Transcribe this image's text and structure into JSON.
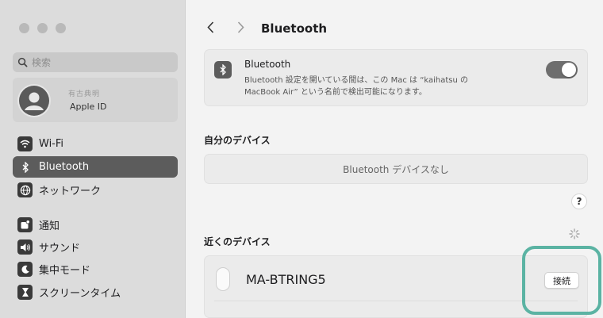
{
  "window": {
    "title": "Bluetooth",
    "traffic_lights": [
      "close",
      "minimize",
      "zoom"
    ]
  },
  "sidebar": {
    "search": {
      "icon": "search-icon",
      "placeholder": "検索"
    },
    "account": {
      "name": "有古典明",
      "label": "Apple ID"
    },
    "items": [
      {
        "label": "Wi-Fi",
        "icon": "wifi-icon"
      },
      {
        "label": "Bluetooth",
        "icon": "bluetooth-icon",
        "active": true
      },
      {
        "label": "ネットワーク",
        "icon": "globe-icon"
      },
      {
        "label": "通知",
        "icon": "notification-icon"
      },
      {
        "label": "サウンド",
        "icon": "speaker-icon"
      },
      {
        "label": "集中モード",
        "icon": "moon-icon"
      },
      {
        "label": "スクリーンタイム",
        "icon": "hourglass-icon"
      }
    ],
    "colors": {
      "active_bg": "#5c5c5c",
      "sidebar_bg": "#dcdcdc"
    }
  },
  "main": {
    "nav": {
      "back_icon": "chevron-left-icon",
      "forward_icon": "chevron-right-icon"
    },
    "bluetooth_card": {
      "title": "Bluetooth",
      "description_line1": "Bluetooth 設定を開いている間は、この Mac は “kaihatsu の",
      "description_line2": "MacBook Air” という名前で検出可能になります。",
      "toggle_on": true
    },
    "my_devices": {
      "heading": "自分のデバイス",
      "empty_text": "Bluetooth デバイスなし"
    },
    "help_label": "?",
    "nearby_devices": {
      "heading": "近くのデバイス",
      "devices": [
        {
          "name": "MA-BTRING5",
          "icon": "mouse-icon",
          "connect_label": "接続"
        }
      ]
    },
    "colors": {
      "highlight": "#5bb3a3",
      "toggle": "#6e6e6e"
    }
  }
}
